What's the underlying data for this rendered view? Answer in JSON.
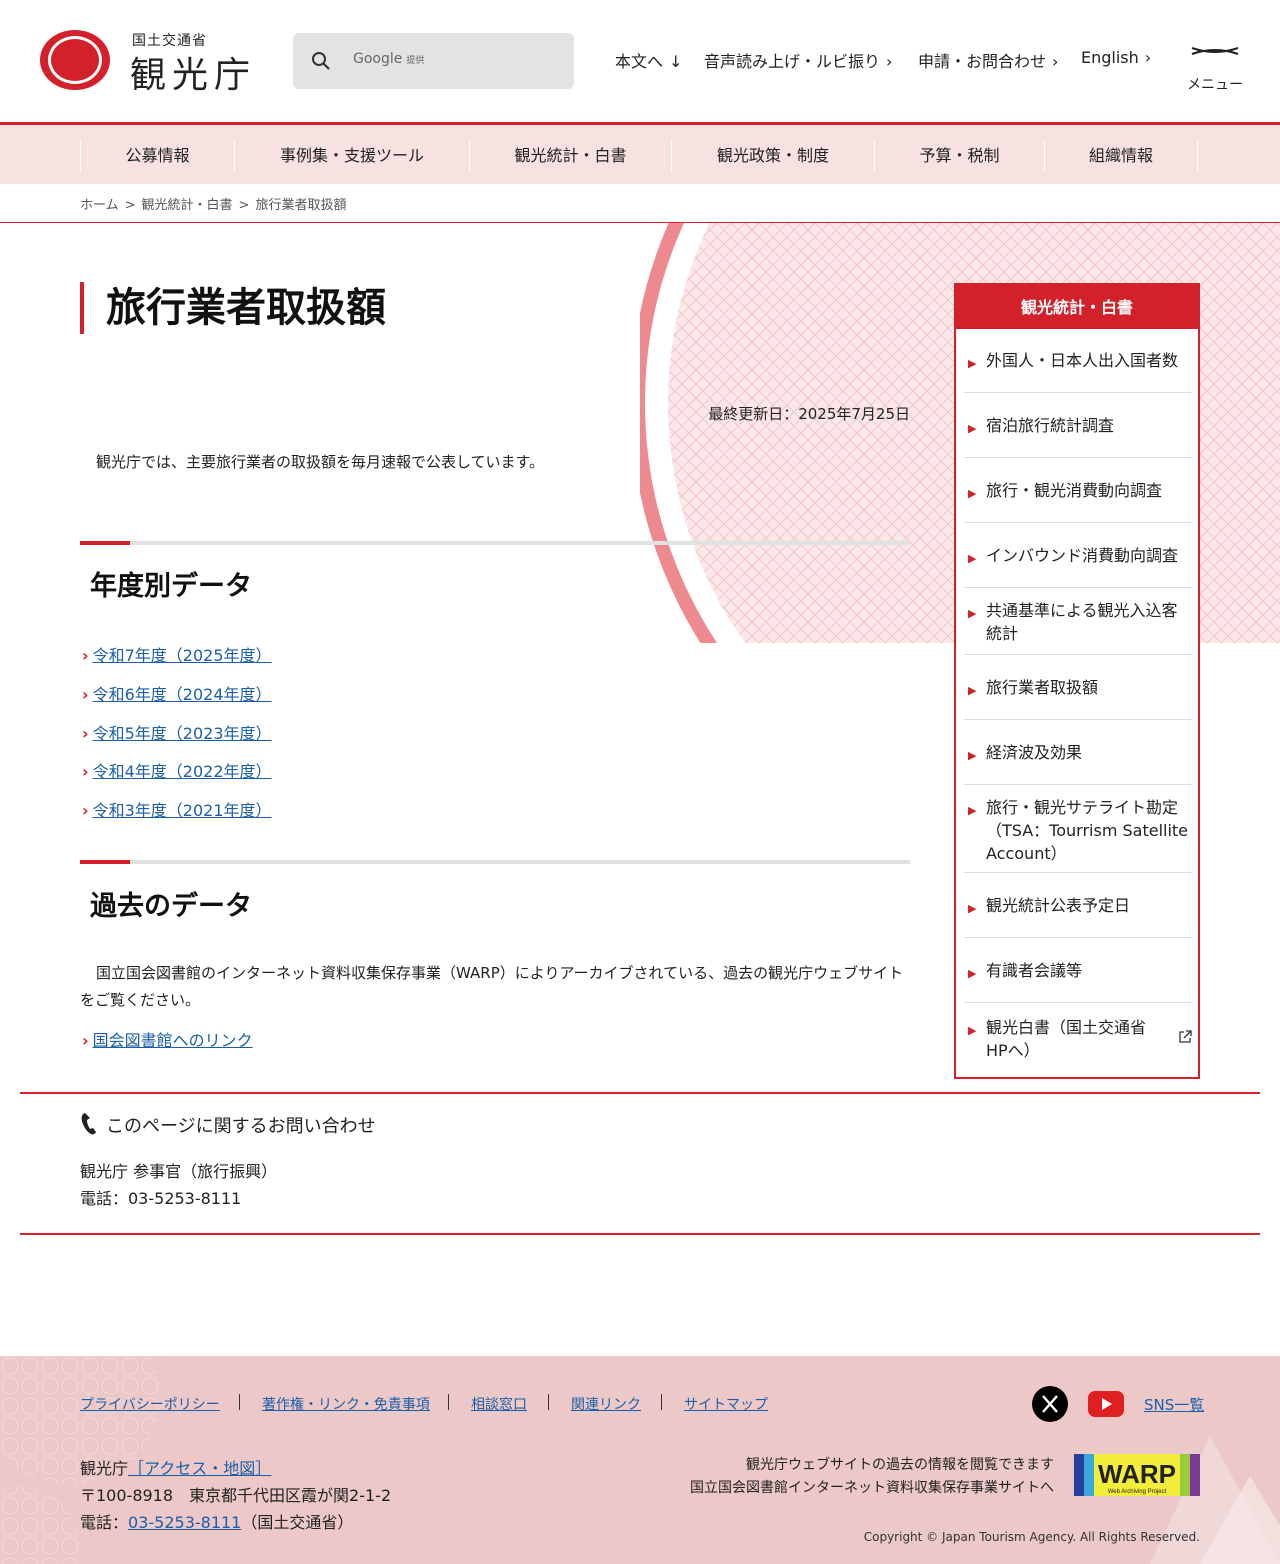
{
  "header": {
    "logo_sub": "国土交通省",
    "logo_main": "観光庁",
    "search_placeholder": "Google",
    "search_provided": "提供",
    "nav": [
      "本文へ",
      "音声読み上げ・ルビ振り",
      "申請・お問合わせ",
      "English"
    ],
    "menu_label": "メニュー"
  },
  "gnav": [
    "公募情報",
    "事例集・支援ツール",
    "観光統計・白書",
    "観光政策・制度",
    "予算・税制",
    "組織情報"
  ],
  "breadcrumb": [
    "ホーム",
    "観光統計・白書",
    "旅行業者取扱額"
  ],
  "main": {
    "title": "旅行業者取扱額",
    "updated": "最終更新日：2025年7月25日",
    "lead": "観光庁では、主要旅行業者の取扱額を毎月速報で公表しています。",
    "section1_title": "年度別データ",
    "years": [
      "令和7年度（2025年度）",
      "令和6年度（2024年度）",
      "令和5年度（2023年度）",
      "令和4年度（2022年度）",
      "令和3年度（2021年度）"
    ],
    "section2_title": "過去のデータ",
    "past_text": "国立国会図書館のインターネット資料収集保存事業（WARP）によりアーカイブされている、過去の観光庁ウェブサイトをご覧ください。",
    "past_link": "国会図書館へのリンク"
  },
  "sidebar": {
    "title": "観光統計・白書",
    "items": [
      "外国人・日本人出入国者数",
      "宿泊旅行統計調査",
      "旅行・観光消費動向調査",
      "インバウンド消費動向調査",
      "共通基準による観光入込客統計",
      "旅行業者取扱額",
      "経済波及効果",
      "旅行・観光サテライト勘定（TSA：Tourrism Satellite Account）",
      "観光統計公表予定日",
      "有識者会議等",
      "観光白書（国土交通省HPへ）"
    ]
  },
  "contact": {
    "title": "このページに関するお問い合わせ",
    "org": "観光庁 参事官（旅行振興）",
    "tel": "電話：03-5253-8111"
  },
  "footer": {
    "links": [
      "プライバシーポリシー",
      "著作権・リンク・免責事項",
      "相談窓口",
      "関連リンク",
      "サイトマップ"
    ],
    "sns_label": "SNS一覧",
    "org": "観光庁",
    "access": "［アクセス・地図］",
    "address": "〒100-8918　東京都千代田区霞が関2-1-2",
    "tel_prefix": "電話：",
    "tel": "03-5253-8111",
    "tel_suffix": "（国土交通省）",
    "warp_line1": "観光庁ウェブサイトの過去の情報を閲覧できます",
    "warp_line2": "国立国会図書館インターネット資料収集保存事業サイトへ",
    "warp_logo": "WARP",
    "warp_logo_sub": "Web Archiving Project",
    "copyright": "Copyright © Japan Tourism Agency. All Rights Reserved."
  },
  "colors": {
    "accent": "#d3212c",
    "nav_bg": "#f7e1e1",
    "footer_bg": "#ecc8c8",
    "link": "#1a5fa8"
  }
}
